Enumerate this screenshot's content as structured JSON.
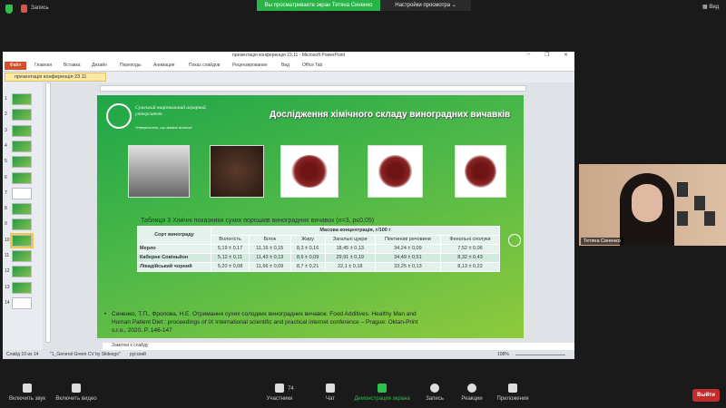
{
  "zoom": {
    "recording_label": "Запись",
    "share_banner": "Вы просматриваете экран Тетяна Синенко",
    "view_options": "Настройки просмотра ⌄",
    "view_button": "▦ Вид",
    "participant_name": "Тетяна Синенко",
    "participants_count": "74",
    "toolbar": [
      "Включить звук",
      "Включить видео",
      "Участники",
      "Чат",
      "Демонстрация экрана",
      "Запись",
      "Реакции",
      "Приложения"
    ],
    "leave": "Выйти",
    "colors": {
      "share": "#28b446",
      "leave": "#c42b2b"
    }
  },
  "ppt": {
    "title": "презентація конференція 23.11 - Microsoft PowerPoint",
    "file_tab": "Файл",
    "tabs": [
      "Главная",
      "Вставка",
      "Дизайн",
      "Переходы",
      "Анимация",
      "Показ слайдов",
      "Рецензирование",
      "Вид",
      "Office Tab"
    ],
    "doc_tab": "презентація конференція 23.11",
    "slide_numbers": [
      "1",
      "2",
      "3",
      "4",
      "5",
      "6",
      "7",
      "8",
      "9",
      "10",
      "11",
      "12",
      "13",
      "14"
    ],
    "notes_placeholder": "Заметки к слайду",
    "status": {
      "slide": "Слайд 10 из 14",
      "theme": "\"1_General Green CV by Slidesgo\"",
      "lang": "русский",
      "zoom": "108%"
    }
  },
  "slide": {
    "university": "Сумський національний аграрний університет",
    "slogan": "Університет, що змінює життя!",
    "title": "Дослідження хімічного складу виноградних вичавків",
    "caption": "Таблиця 3   Хімічні показники сухих порошків виноградних вичавок (n=3, p≤0,05)",
    "table": {
      "col_group": "Масова концентрація, г/100 г",
      "row_header": "Сорт винограду",
      "columns": [
        "Вологість",
        "Білок",
        "Жиру",
        "Загальні цукри",
        "Пектинові речовини",
        "Фенольні сполуки"
      ],
      "rows": [
        {
          "name": "Мерло",
          "values": [
            "5,19 ± 0,17",
            "11,16 ± 0,15",
            "8,3 ± 0,16",
            "18,45 ± 0,13",
            "34,24 ± 0,09",
            "7,52 ± 0,06"
          ]
        },
        {
          "name": "Каберне Совіньйон",
          "values": [
            "5,12 ± 0,11",
            "11,43 ± 0,13",
            "8,6 ± 0,09",
            "29,91 ± 0,19",
            "34,49 ± 0,51",
            "8,32 ± 0,43"
          ]
        },
        {
          "name": "Лівадійський чорний",
          "values": [
            "5,20 ± 0,08",
            "11,66 ± 0,09",
            "8,7 ± 0,21",
            "22,1 ± 0,18",
            "33,25 ± 0,13",
            "8,13 ± 0,22"
          ]
        }
      ]
    },
    "reference": "Синенко, Т.П., Фролова, Н.Е. Отримання сухих солодких виноградних вичавок. Food Additives. Healthy Man and Human Patient Diet : proceedings of IX International scientific and practical internet conference – Prague: Oktan-Print s.r.o., 2020. P. 146-147"
  }
}
